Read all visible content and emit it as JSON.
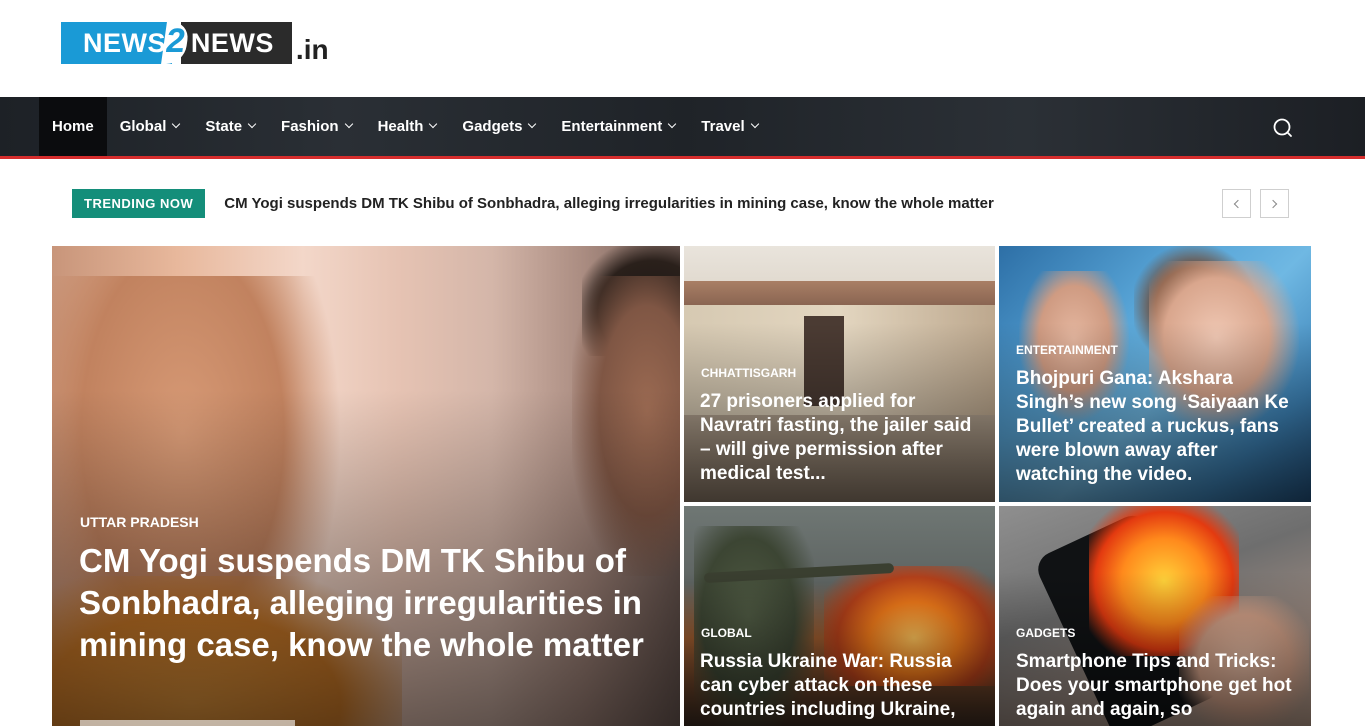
{
  "logo": {
    "part1": "NEWS",
    "number": "2",
    "part2": "NEWS",
    "tld": ".in"
  },
  "nav": {
    "items": [
      {
        "label": "Home",
        "dropdown": false,
        "active": true
      },
      {
        "label": "Global",
        "dropdown": true
      },
      {
        "label": "State",
        "dropdown": true
      },
      {
        "label": "Fashion",
        "dropdown": true
      },
      {
        "label": "Health",
        "dropdown": true
      },
      {
        "label": "Gadgets",
        "dropdown": true
      },
      {
        "label": "Entertainment",
        "dropdown": true
      },
      {
        "label": "Travel",
        "dropdown": true
      }
    ],
    "search_icon": "search-icon"
  },
  "trending": {
    "badge": "TRENDING NOW",
    "headline": "CM Yogi suspends DM TK Shibu of Sonbhadra, alleging irregularities in mining case, know the whole matter",
    "prev_icon": "chevron-left-icon",
    "next_icon": "chevron-right-icon"
  },
  "featured": {
    "category": "UTTAR PRADESH",
    "title": "CM Yogi suspends DM TK Shibu of Sonbhadra, alleging irregularities in mining case, know the whole matter"
  },
  "tiles": [
    {
      "category": "CHHATTISGARH",
      "title": "27 prisoners applied for Navratri fasting, the jailer said – will give permission after medical test..."
    },
    {
      "category": "ENTERTAINMENT",
      "title": "Bhojpuri Gana: Akshara Singh’s new song ‘Saiyaan Ke Bullet’ created a ruckus, fans were blown away after watching the video."
    },
    {
      "category": "GLOBAL",
      "title": "Russia Ukraine War: Russia can cyber attack on these countries including Ukraine,"
    },
    {
      "category": "GADGETS",
      "title": "Smartphone Tips and Tricks: Does your smartphone get hot again and again, so"
    }
  ],
  "colors": {
    "brand_blue": "#1a9ad6",
    "nav_bg": "#23272c",
    "nav_accent": "#d62d2d",
    "trending_badge": "#148e7a"
  }
}
